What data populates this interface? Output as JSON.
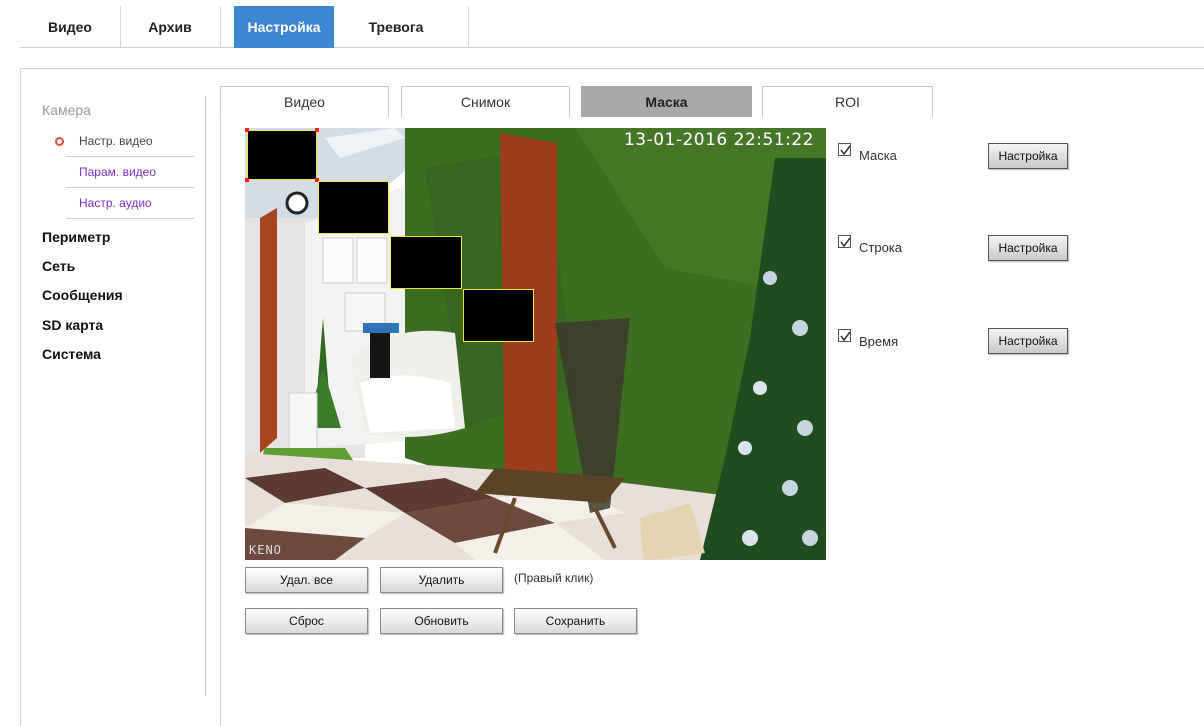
{
  "topnav": {
    "tabs": [
      {
        "label": "Видео",
        "active": false
      },
      {
        "label": "Архив",
        "active": false
      },
      {
        "label": "Настройка",
        "active": true
      },
      {
        "label": "Тревога",
        "active": false
      }
    ]
  },
  "sidebar": {
    "camera_title": "Камера",
    "camera_items": [
      {
        "label": "Настр. видео",
        "current": true
      },
      {
        "label": "Парам. видео",
        "current": false
      },
      {
        "label": "Настр. аудио",
        "current": false
      }
    ],
    "menu": [
      "Периметр",
      "Сеть",
      "Сообщения",
      "SD карта",
      "Система"
    ]
  },
  "settings_tabs": [
    {
      "label": "Видео",
      "active": false
    },
    {
      "label": "Снимок",
      "active": false
    },
    {
      "label": "Маска",
      "active": true
    },
    {
      "label": "ROI",
      "active": false
    }
  ],
  "video": {
    "timestamp": "13-01-2016 22:51:22",
    "osd_name": "KENO",
    "mask_count": 4
  },
  "options": [
    {
      "label": "Маска",
      "checked": true,
      "button": "Настройка"
    },
    {
      "label": "Строка",
      "checked": true,
      "button": "Настройка"
    },
    {
      "label": "Время",
      "checked": true,
      "button": "Настройка"
    }
  ],
  "actions": {
    "delete_all": "Удал. все",
    "delete": "Удалить",
    "hint": "(Правый клик)",
    "reset": "Сброс",
    "refresh": "Обновить",
    "save": "Сохранить"
  },
  "colors": {
    "accent": "#3c86d4",
    "active_subtab": "#a9a9a9",
    "link_purple": "#7a33c8",
    "bullet_red": "#e24b3b",
    "mask_border": "#f0e34a"
  }
}
